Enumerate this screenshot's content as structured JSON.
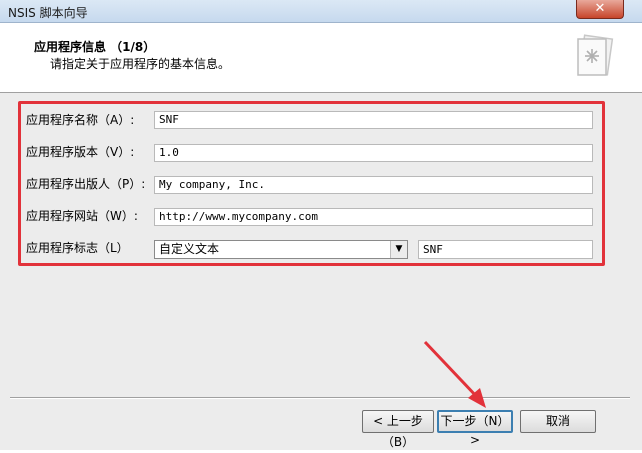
{
  "window": {
    "title": "NSIS 脚本向导",
    "close_glyph": "✕"
  },
  "header": {
    "title": "应用程序信息 （1/8）",
    "subtitle": "请指定关于应用程序的基本信息。"
  },
  "form": {
    "rows": [
      {
        "label": "应用程序名称（A）:",
        "value": "SNF"
      },
      {
        "label": "应用程序版本（V）:",
        "value": "1.0"
      },
      {
        "label": "应用程序出版人（P）:",
        "value": "My company, Inc."
      },
      {
        "label": "应用程序网站（W）:",
        "value": "http://www.mycompany.com"
      }
    ],
    "logo": {
      "label": "应用程序标志（L）",
      "select_value": "自定义文本",
      "text_value": "SNF"
    }
  },
  "buttons": {
    "prev": "< 上一步（B）",
    "next": "下一步（N） >",
    "cancel": "取消"
  },
  "colors": {
    "annotation_red": "#e2323a",
    "focus_blue": "#3c7fb1"
  }
}
